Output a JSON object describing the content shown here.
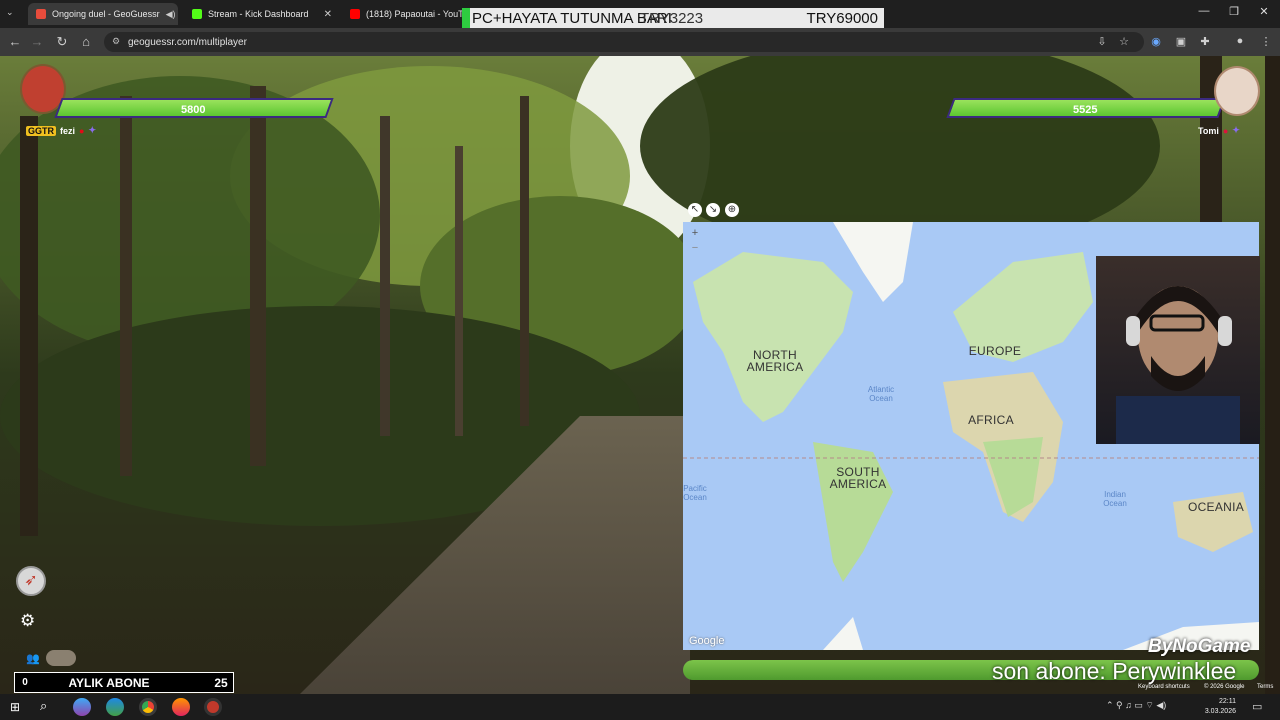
{
  "browser": {
    "tabs": [
      {
        "title": "Ongoing duel - GeoGuessr",
        "color": "#e74c3c"
      },
      {
        "title": "Stream - Kick Dashboard",
        "color": "#53fc18"
      },
      {
        "title": "(1818) Papaoutai - YouTube",
        "color": "#ff0000"
      }
    ],
    "url": "geoguessr.com/multiplayer"
  },
  "ticker": {
    "text": "PC+HAYATA TUTUNMA BARI",
    "amount_left": "TRY3223",
    "amount_right": "TRY69000"
  },
  "player_left": {
    "score": "5800",
    "name": "fezi",
    "badge": "GGTR",
    "health": 1.0
  },
  "player_right": {
    "score": "5525",
    "name": "Tomi",
    "health": 0.95
  },
  "map": {
    "labels": {
      "north_america": "NORTH AMERICA",
      "europe": "EUROPE",
      "africa": "AFRICA",
      "south_america": "SOUTH AMERICA",
      "oceania": "OCEANIA",
      "atlantic": "Atlantic Ocean",
      "indian": "Indian Ocean",
      "pacific": "Pacific Ocean"
    },
    "attribution": "Google",
    "footer": {
      "shortcuts": "Keyboard shortcuts",
      "copyright": "© 2026 Google",
      "terms": "Terms"
    }
  },
  "overlay": {
    "last_sub": "son abone: Perywinklee",
    "brand": "ByNoGame",
    "monthly_label": "AYLIK ABONE",
    "monthly_left": "0",
    "monthly_right": "25"
  },
  "taskbar": {
    "time": "22:11",
    "date": "3.03.2026"
  }
}
